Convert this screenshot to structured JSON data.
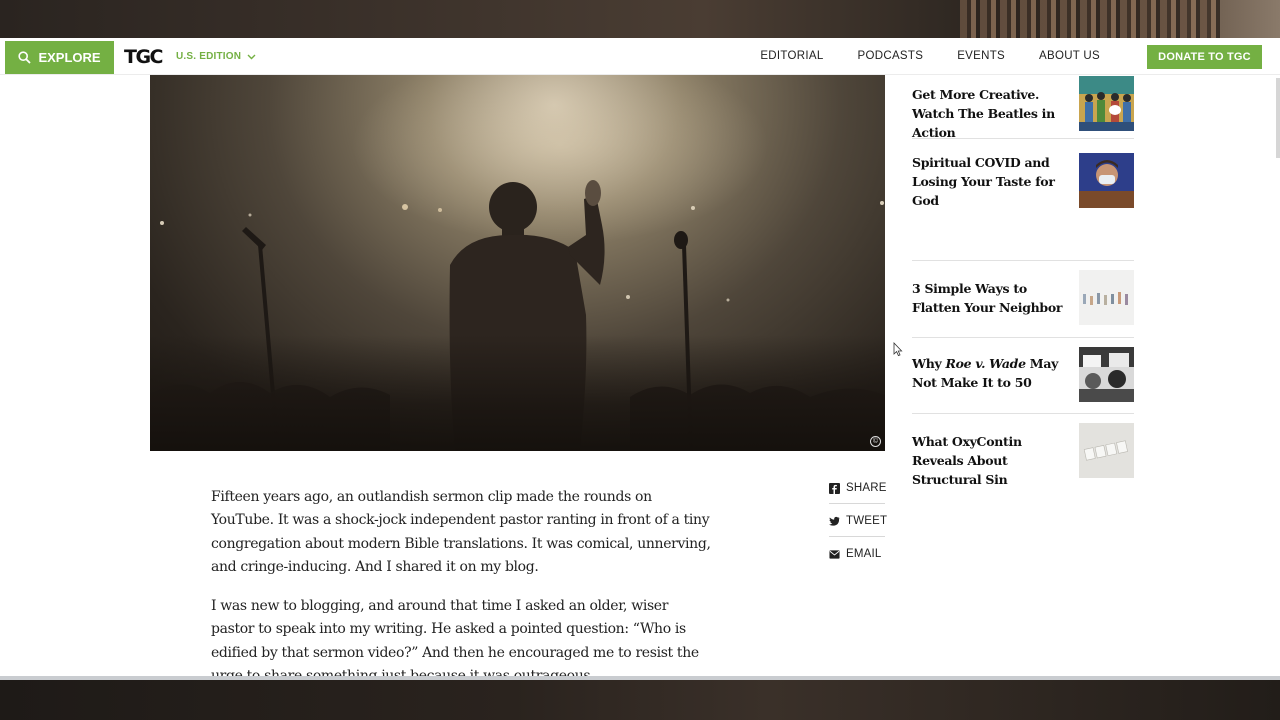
{
  "nav": {
    "explore_label": "EXPLORE",
    "logo_text": "TGC",
    "edition_label": "U.S. EDITION",
    "links": [
      "EDITORIAL",
      "PODCASTS",
      "EVENTS",
      "ABOUT US"
    ],
    "donate_label": "DONATE TO TGC"
  },
  "hero": {
    "copyright_symbol": "©"
  },
  "sidebar": {
    "items": [
      {
        "title": "Get More Creative. Watch The Beatles in Action",
        "thumb": "beatles-illustration"
      },
      {
        "title": "Spiritual COVID and Losing Your Taste for God",
        "thumb": "masked-person-photo"
      },
      {
        "title": "3 Simple Ways to Flatten Your Neighbor",
        "thumb": "small-figures-photo"
      },
      {
        "title_pre": "Why ",
        "title_em": "Roe v. Wade",
        "title_post": " May Not Make It to 50",
        "thumb": "protest-photo"
      },
      {
        "title": "What OxyContin Reveals About Structural Sin",
        "thumb": "help-letters-photo"
      }
    ]
  },
  "share": {
    "items": [
      {
        "label": "SHARE",
        "icon": "facebook-icon"
      },
      {
        "label": "TWEET",
        "icon": "twitter-icon"
      },
      {
        "label": "EMAIL",
        "icon": "email-icon"
      }
    ]
  },
  "article": {
    "paragraphs": [
      "Fifteen years ago, an outlandish sermon clip made the rounds on YouTube. It was a shock-jock independent pastor ranting in front of a tiny congregation about modern Bible translations. It was comical, unnerving, and cringe-inducing. And I shared it on my blog.",
      "I was new to blogging, and around that time I asked an older, wiser pastor to speak into my writing. He asked a pointed question: “Who is edified by that sermon video?” And then he encouraged me to resist the urge to share something just because it was outrageous."
    ]
  },
  "colors": {
    "accent": "#74b043",
    "text": "#222222"
  }
}
